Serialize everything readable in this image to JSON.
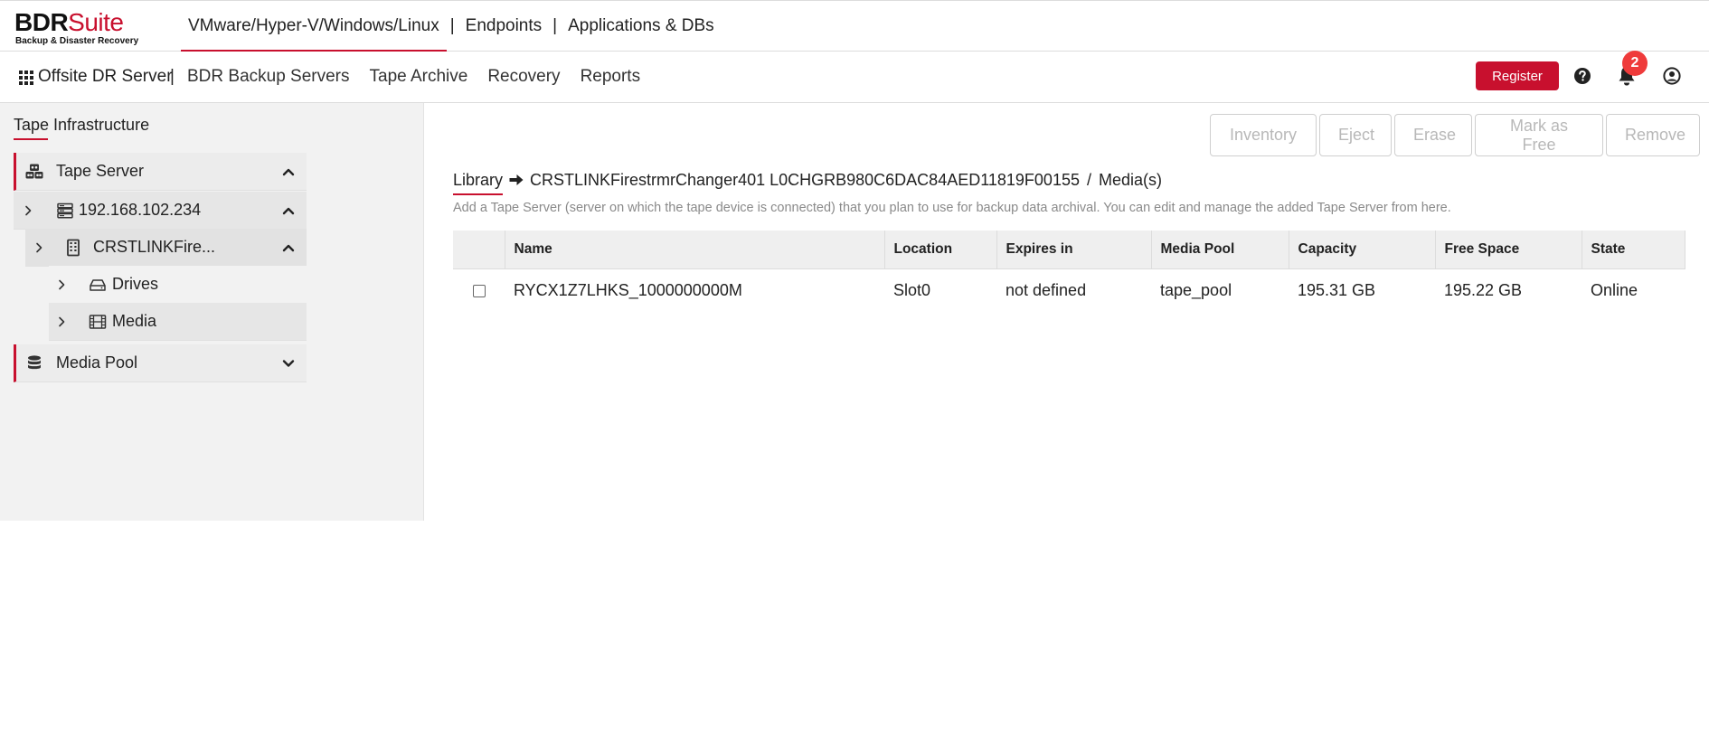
{
  "brand": {
    "name_dark": "BDR",
    "name_accent": "Suite",
    "tagline": "Backup & Disaster Recovery",
    "accent_color": "#c8102e"
  },
  "product_nav": {
    "items": [
      {
        "label": "VMware/Hyper-V/Windows/Linux",
        "active": true
      },
      {
        "label": "Endpoints",
        "active": false
      },
      {
        "label": "Applications & DBs",
        "active": false
      }
    ],
    "separator": "|"
  },
  "sub_nav": {
    "apps_icon": "grid-apps-icon",
    "server_name": "Offsite DR Server",
    "separator": "|",
    "items": [
      {
        "label": "BDR Backup Servers"
      },
      {
        "label": "Tape Archive"
      },
      {
        "label": "Recovery"
      },
      {
        "label": "Reports"
      }
    ],
    "register_label": "Register",
    "notification_count": "2"
  },
  "sidebar": {
    "title": "Tape Infrastructure",
    "tree": {
      "tape_server": "Tape Server",
      "server_ip": "192.168.102.234",
      "library": "CRSTLINKFire...",
      "drives": "Drives",
      "media": "Media",
      "media_pool": "Media Pool"
    }
  },
  "toolbar": {
    "inventory": "Inventory",
    "eject": "Eject",
    "erase": "Erase",
    "mark_free": "Mark as Free",
    "remove": "Remove"
  },
  "breadcrumb": {
    "root": "Library",
    "path": "CRSTLINKFirestrmrChanger401 L0CHGRB980C6DAC84AED11819F00155",
    "separator": "/",
    "leaf": "Media(s)"
  },
  "description": "Add a Tape Server (server on which the tape device is connected) that you plan to use for backup data archival. You can edit and manage the added Tape Server from here.",
  "table": {
    "columns": [
      "Name",
      "Location",
      "Expires in",
      "Media Pool",
      "Capacity",
      "Free Space",
      "State"
    ],
    "rows": [
      {
        "name": "RYCX1Z7LHKS_1000000000M",
        "location": "Slot0",
        "expires": "not defined",
        "pool": "tape_pool",
        "capacity": "195.31 GB",
        "free": "195.22 GB",
        "state": "Online"
      }
    ]
  }
}
